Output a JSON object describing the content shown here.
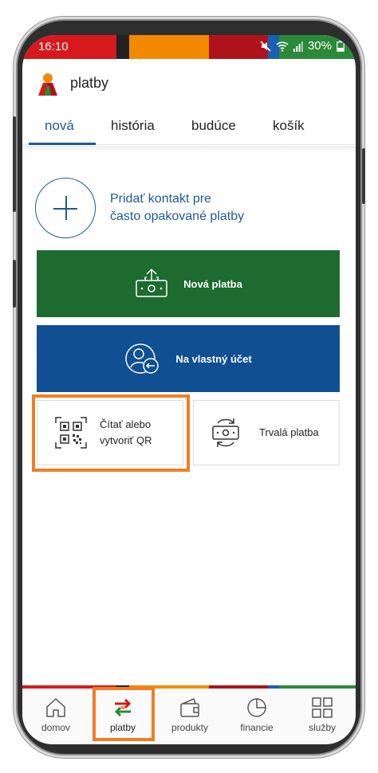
{
  "status_bar": {
    "time": "16:10",
    "battery": "30%",
    "icons": [
      "mute-icon",
      "wifi-icon",
      "signal-icon",
      "battery-icon"
    ]
  },
  "header": {
    "title": "platby",
    "logo_icon": "bank-logo-icon"
  },
  "tabs": [
    {
      "label": "nová",
      "active": true
    },
    {
      "label": "história",
      "active": false
    },
    {
      "label": "budúce",
      "active": false
    },
    {
      "label": "košík",
      "active": false
    }
  ],
  "add_contact": {
    "line1": "Pridať kontakt pre",
    "line2": "často opakované platby",
    "icon": "plus-icon"
  },
  "tiles": {
    "new_payment": {
      "label": "Nová platba",
      "icon": "money-upload-icon"
    },
    "own_account": {
      "label": "Na vlastný účet",
      "icon": "account-transfer-icon"
    },
    "qr": {
      "line1": "Čítať alebo",
      "line2": "vytvoriť QR",
      "icon": "qr-code-icon"
    },
    "standing_order": {
      "label": "Trvalá platba",
      "icon": "recurring-money-icon"
    }
  },
  "bottom_nav": [
    {
      "label": "domov",
      "icon": "home-icon"
    },
    {
      "label": "platby",
      "icon": "transfer-arrows-icon",
      "active": true
    },
    {
      "label": "produkty",
      "icon": "wallet-icon"
    },
    {
      "label": "financie",
      "icon": "pie-chart-icon"
    },
    {
      "label": "služby",
      "icon": "grid-icon"
    }
  ],
  "colors": {
    "primary_blue": "#1f5a92",
    "tile_green": "#1d6b2f",
    "tile_blue": "#0f4f92",
    "highlight_orange": "#f07e24",
    "stripe": [
      "#d7191c",
      "#222222",
      "#f28a00",
      "#b0121b",
      "#1a5fb4",
      "#2a8a3a"
    ]
  }
}
